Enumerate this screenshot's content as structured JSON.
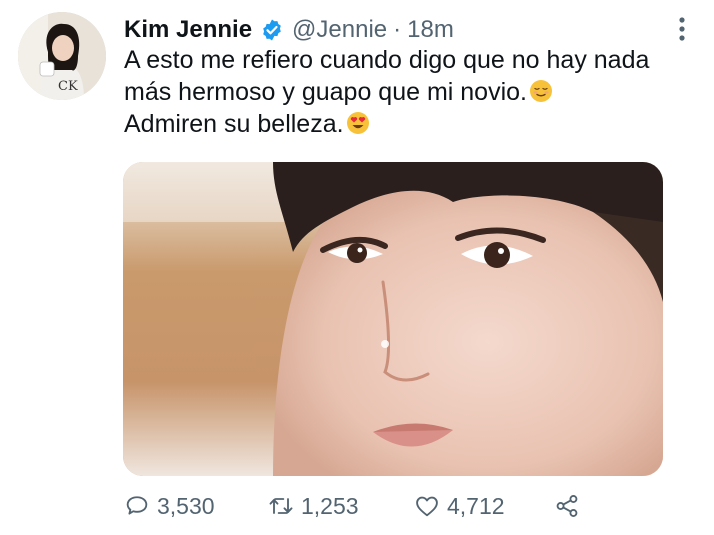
{
  "tweet": {
    "author": {
      "display_name": "Kim Jennie",
      "handle": "@Jennie",
      "verified": true,
      "separator": "·",
      "time": "18m"
    },
    "text_lines": [
      "A esto me refiero cuando digo que no hay nada",
      "más hermoso y guapo que mi novio.",
      "Admiren su belleza."
    ],
    "emojis": [
      "relieved-face-emoji",
      "heart-eyes-emoji"
    ],
    "stats": {
      "replies": "3,530",
      "retweets": "1,253",
      "likes": "4,712"
    },
    "icons": {
      "verified": "verified-badge-icon",
      "more": "more-vertical-icon",
      "reply": "reply-icon",
      "retweet": "retweet-icon",
      "like": "heart-icon",
      "share": "share-icon"
    },
    "colors": {
      "verified_blue": "#1d9bf0",
      "text_primary": "#0f1419",
      "text_secondary": "#536471"
    }
  }
}
